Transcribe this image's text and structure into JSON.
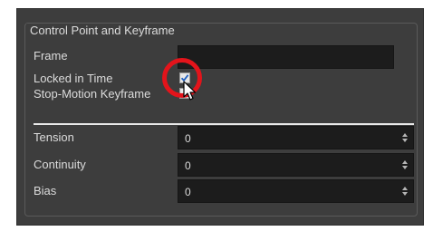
{
  "group_title": "Control Point and Keyframe",
  "frame": {
    "label": "Frame",
    "value": ""
  },
  "locked_in_time": {
    "label": "Locked in Time",
    "checked": true
  },
  "stop_motion_keyframe": {
    "label": "Stop-Motion Keyframe",
    "checked": false
  },
  "tension": {
    "label": "Tension",
    "value": "0"
  },
  "continuity": {
    "label": "Continuity",
    "value": "0"
  },
  "bias": {
    "label": "Bias",
    "value": "0"
  },
  "colors": {
    "panel_bg": "#3d3d3d",
    "field_bg": "#1c1c1c",
    "text": "#dcdcdc",
    "highlight_ring": "#e3141b"
  }
}
